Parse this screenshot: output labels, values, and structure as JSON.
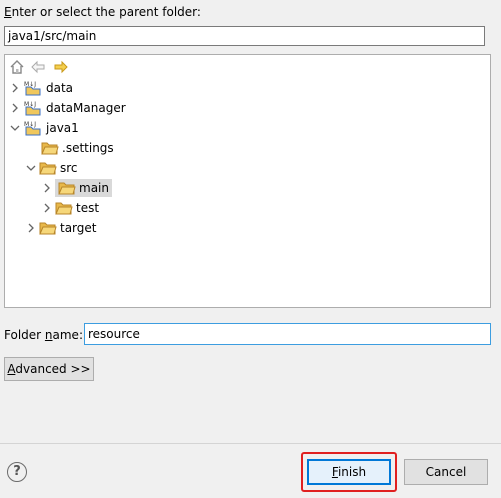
{
  "parent": {
    "label_mnemonic": "E",
    "label_rest": "nter or select the parent folder:",
    "path_value": "java1/src/main"
  },
  "toolbar": {
    "home_icon": "home-icon",
    "back_icon": "back-arrow-icon",
    "forward_icon": "forward-arrow-icon"
  },
  "tree": {
    "items": [
      {
        "label": "data",
        "type": "project",
        "state": "collapsed"
      },
      {
        "label": "dataManager",
        "type": "project",
        "state": "collapsed"
      },
      {
        "label": "java1",
        "type": "project",
        "state": "expanded"
      },
      {
        "label": ".settings",
        "type": "folder",
        "state": "leaf"
      },
      {
        "label": "src",
        "type": "folder",
        "state": "expanded"
      },
      {
        "label": "main",
        "type": "folder",
        "state": "collapsed",
        "selected": true
      },
      {
        "label": "test",
        "type": "folder",
        "state": "collapsed"
      },
      {
        "label": "target",
        "type": "folder",
        "state": "collapsed"
      }
    ]
  },
  "folder_name": {
    "label_pre": "Folder ",
    "label_mnemonic": "n",
    "label_post": "ame:",
    "value": "resource"
  },
  "advanced": {
    "label_mnemonic": "A",
    "label_rest": "dvanced >>"
  },
  "footer": {
    "help_label": "?",
    "finish_mnemonic": "F",
    "finish_rest": "inish",
    "cancel_label": "Cancel"
  },
  "colors": {
    "folder": "#e8b84a",
    "project": "#3a6fc4",
    "highlight": "#e02020",
    "focus": "#0078d7"
  }
}
